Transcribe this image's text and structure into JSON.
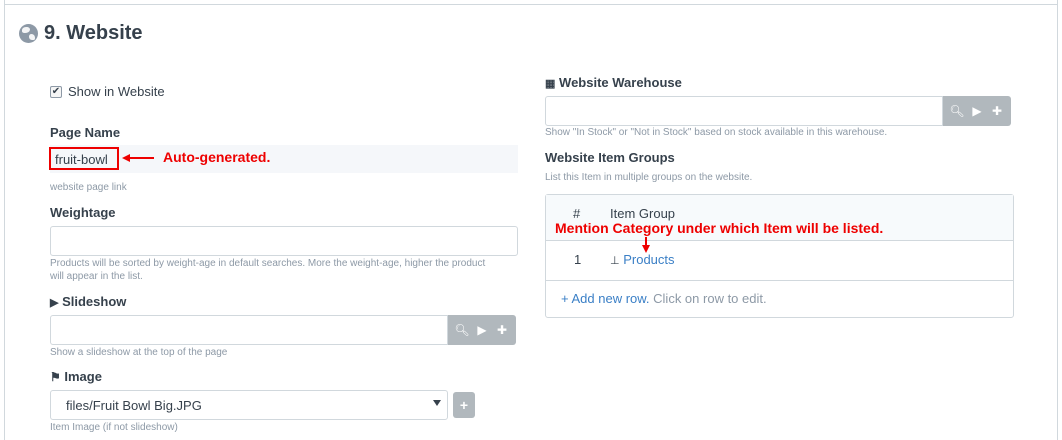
{
  "section": {
    "title": "9. Website",
    "icon": "globe-icon"
  },
  "show_in_website": {
    "label": "Show in Website",
    "checked": true
  },
  "page_name": {
    "label": "Page Name",
    "value": "fruit-bowl",
    "help": "website page link",
    "annotation": "Auto-generated."
  },
  "weightage": {
    "label": "Weightage",
    "value": "",
    "help_line1": "Products will be sorted by weight-age in default searches. More the weight-age, higher the product",
    "help_line2": "will appear in the list."
  },
  "slideshow": {
    "label": "Slideshow",
    "value": "",
    "help": "Show a slideshow at the top of the page"
  },
  "image": {
    "label": "Image",
    "value": "files/Fruit Bowl Big.JPG",
    "help": "Item Image (if not slideshow)"
  },
  "website_warehouse": {
    "label": "Website Warehouse",
    "value": "",
    "help": "Show \"In Stock\" or \"Not in Stock\" based on stock available in this warehouse."
  },
  "item_groups": {
    "label": "Website Item Groups",
    "help": "List this Item in multiple groups on the website.",
    "columns": [
      "#",
      "Item Group"
    ],
    "annotation": "Mention Category under which Item will be listed.",
    "rows": [
      {
        "idx": "1",
        "item_group": "Products"
      }
    ],
    "add_row": "+ Add new row.",
    "add_row_hint": "Click on row to edit."
  },
  "colors": {
    "annotation": "#ee0000",
    "link": "#3a7fc6",
    "button": "#b1b8bd"
  }
}
